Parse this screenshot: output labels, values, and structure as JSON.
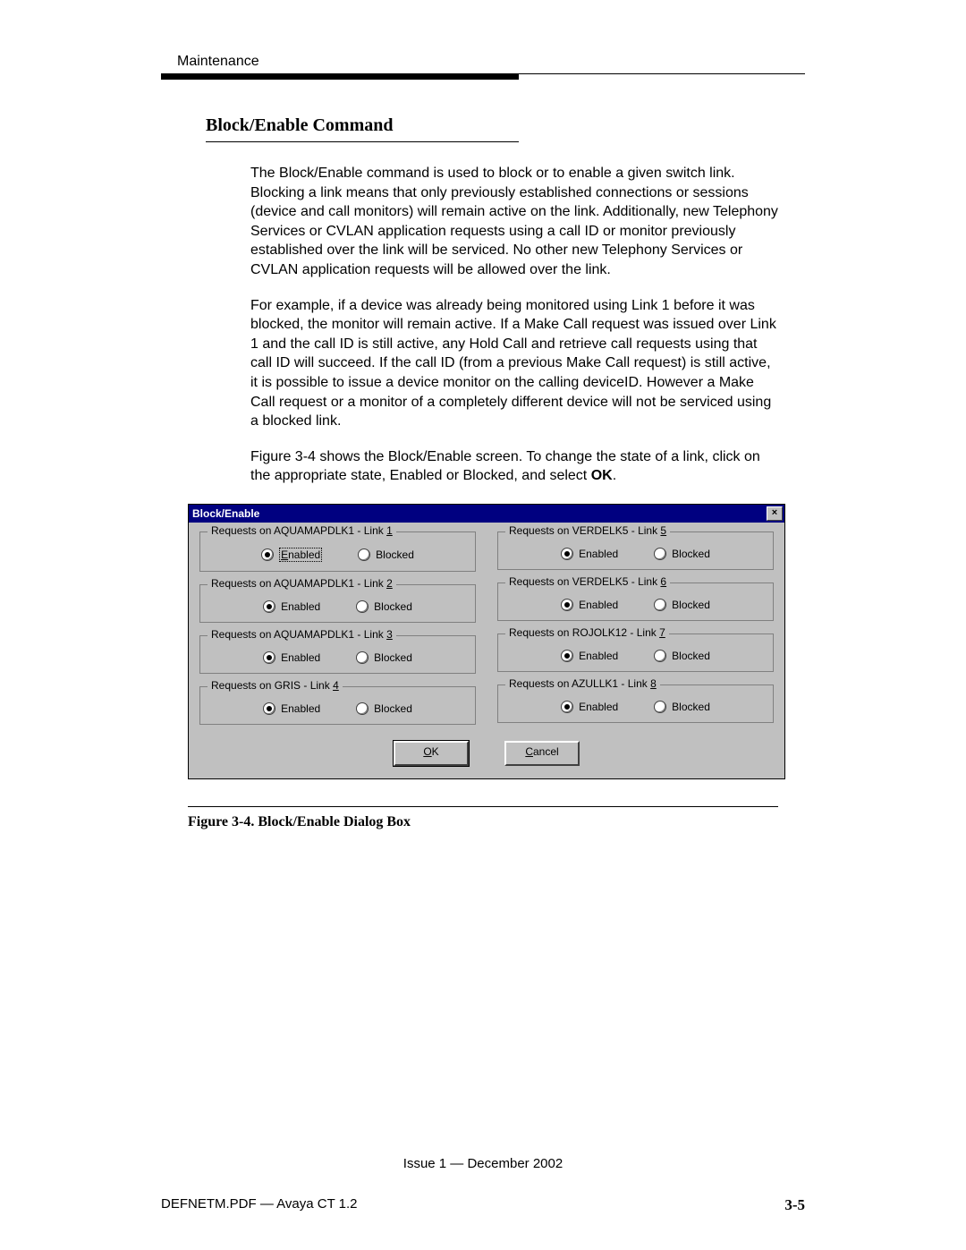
{
  "header": {
    "section": "Maintenance"
  },
  "section": {
    "heading": "Block/Enable Command",
    "para1": "The Block/Enable command is used to block or to enable a given switch link. Blocking a link means that only previously established connections or sessions (device and call monitors) will remain active on the link.  Additionally, new Telephony Services or CVLAN application requests using a call ID or monitor previously established over the link will be serviced.  No other new Telephony Services or CVLAN application requests will be allowed over the link.",
    "para2": "For example, if a device was already being monitored using Link 1 before it was blocked, the monitor will remain active.  If a Make Call request was issued over Link 1 and the call ID is still active, any Hold Call and retrieve call requests using that call ID will succeed.  If the call ID (from a previous Make Call request) is still active, it is possible to issue a device monitor on the calling deviceID.   However a Make Call request or a monitor of a completely different device will not be serviced using a blocked link.",
    "para3_pre": "Figure 3-4 shows the Block/Enable screen. To change the state of a link, click on the appropriate state, Enabled or Blocked, and select ",
    "para3_bold": "OK",
    "para3_post": "."
  },
  "dialog": {
    "title": "Block/Enable",
    "close_label": "×",
    "enabled_label_accel": "E",
    "enabled_label_rest": "nabled",
    "enabled_label": "Enabled",
    "blocked_label": "Blocked",
    "ok_accel": "O",
    "ok_rest": "K",
    "cancel_accel": "C",
    "cancel_rest": "ancel",
    "groups_left": [
      {
        "prefix": "Requests on AQUAMAPDLK1 - Link ",
        "num": "1",
        "focused": true
      },
      {
        "prefix": "Requests on AQUAMAPDLK1 - Link ",
        "num": "2",
        "focused": false
      },
      {
        "prefix": "Requests on AQUAMAPDLK1 - Link ",
        "num": "3",
        "focused": false
      },
      {
        "prefix": "Requests on GRIS - Link ",
        "num": "4",
        "focused": false
      }
    ],
    "groups_right": [
      {
        "prefix": "Requests on VERDELK5 - Link ",
        "num": "5"
      },
      {
        "prefix": "Requests on VERDELK5 - Link ",
        "num": "6"
      },
      {
        "prefix": "Requests on ROJOLK12 - Link ",
        "num": "7"
      },
      {
        "prefix": "Requests on AZULLK1 - Link ",
        "num": "8"
      }
    ]
  },
  "figure": {
    "caption": "Figure 3-4.    Block/Enable Dialog Box"
  },
  "footer": {
    "issue": "Issue 1 — December 2002",
    "doc": "DEFNETM.PDF — Avaya CT 1.2",
    "page": "3-5"
  }
}
